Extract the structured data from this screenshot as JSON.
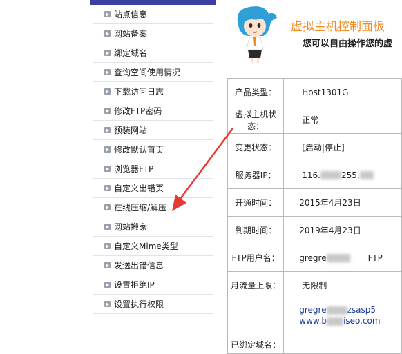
{
  "sidebar": {
    "items": [
      {
        "label": "站点信息"
      },
      {
        "label": "网站备案"
      },
      {
        "label": "绑定域名"
      },
      {
        "label": "查询空间使用情况"
      },
      {
        "label": "下载访问日志"
      },
      {
        "label": "修改FTP密码"
      },
      {
        "label": "预装网站"
      },
      {
        "label": "修改默认首页"
      },
      {
        "label": "浏览器FTP"
      },
      {
        "label": "自定义出错页"
      },
      {
        "label": "在线压缩/解压"
      },
      {
        "label": "网站搬家"
      },
      {
        "label": "自定义Mime类型"
      },
      {
        "label": "发送出错信息"
      },
      {
        "label": "设置拒绝IP"
      },
      {
        "label": "设置执行权限"
      }
    ]
  },
  "header": {
    "title": "虚拟主机控制面板",
    "subtitle": "您可以自由操作您的虚"
  },
  "info": {
    "rows": [
      {
        "key": "产品类型：",
        "value": "Host1301G"
      },
      {
        "key": "虚拟主机状态：",
        "value": "正常"
      },
      {
        "key": "变更状态：",
        "value": "[启动|停止]"
      },
      {
        "key": "服务器IP：",
        "value_a": "116.",
        "value_b": "255."
      },
      {
        "key": "开通时间：",
        "value": "2015年4月23日"
      },
      {
        "key": "到期时间：",
        "value": "2019年4月23日"
      },
      {
        "key": "FTP用户名：",
        "value_a": "gregre",
        "value_b": "FTP"
      },
      {
        "key": "月流量上限：",
        "value": "无限制"
      },
      {
        "key": "已绑定域名：",
        "value_a": "gregre",
        "value_b": "zsasp5",
        "value_c": "www.b",
        "value_d": "iseo.com"
      }
    ]
  },
  "colors": {
    "accent_title": "#f28a1d",
    "sidebar_topbar": "#3a3fa0",
    "arrow": "#e53935",
    "link_blue": "#1a3a9c"
  }
}
